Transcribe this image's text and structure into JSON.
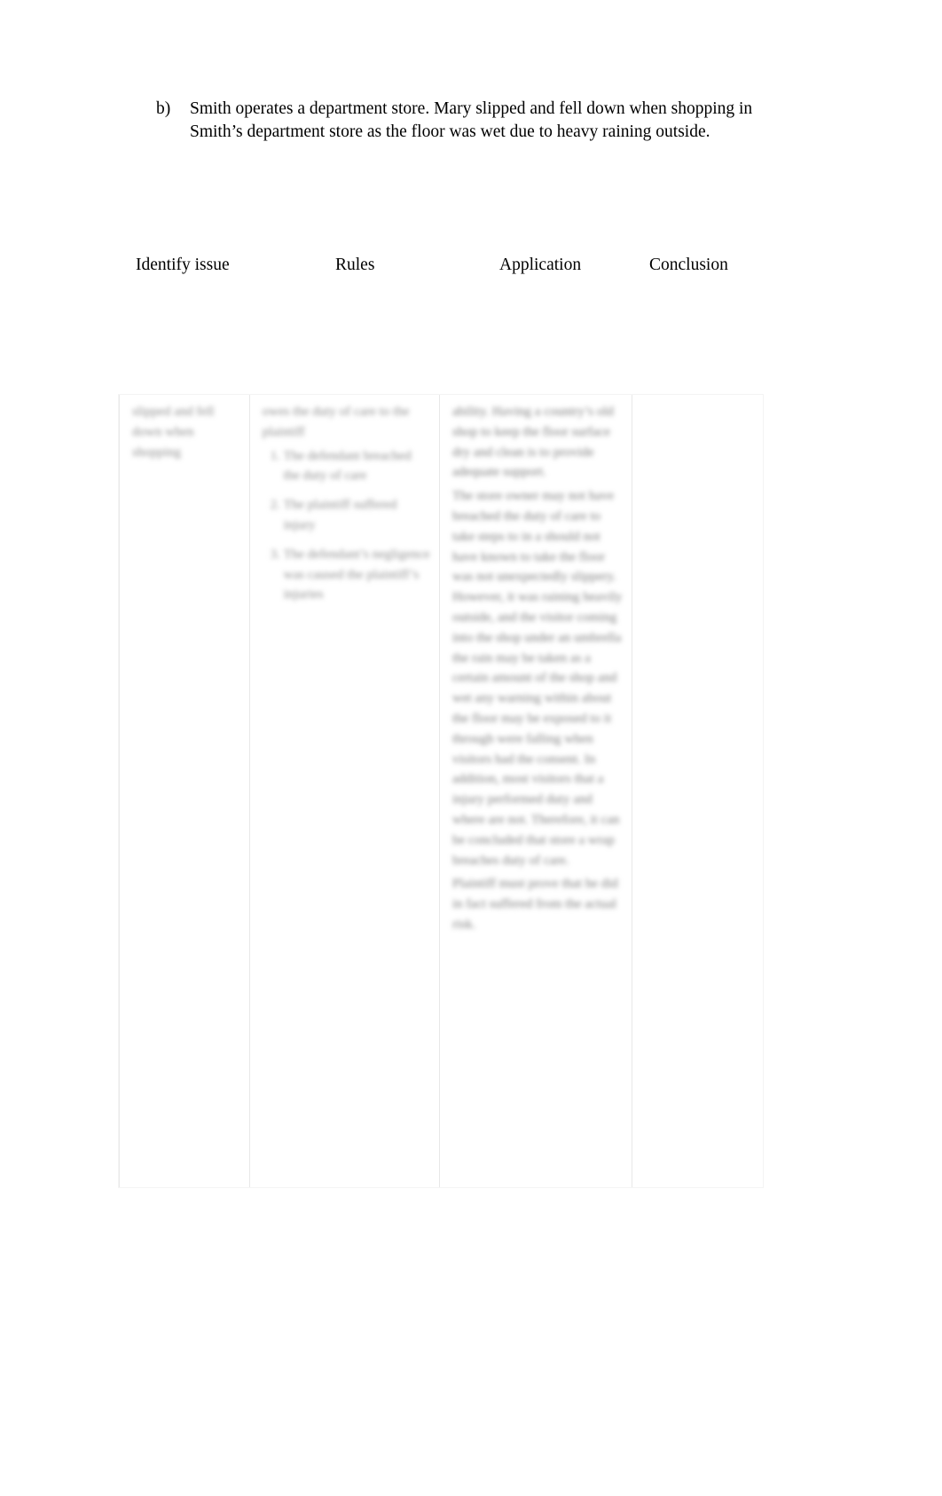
{
  "document": {
    "question": {
      "marker": "b)",
      "text": "Smith operates a department store. Mary slipped and fell down when shopping in Smith’s department store as the floor was wet due to heavy raining outside."
    },
    "column_headings": [
      {
        "label": "Identify issue"
      },
      {
        "label": "Rules"
      },
      {
        "label": "Application"
      },
      {
        "label": "Conclusion"
      }
    ],
    "table": {
      "columns": [
        {
          "name": "identify-issue",
          "redacted": true,
          "paragraphs": [
            "slipped and fell down when shopping"
          ],
          "list": []
        },
        {
          "name": "rules",
          "redacted": true,
          "paragraphs": [
            "owes the duty of care to the plaintiff"
          ],
          "list": [
            "The defendant breached the duty of care",
            "The plaintiff suffered injury",
            "The defendant’s negligence was caused the plaintiff’s injuries"
          ]
        },
        {
          "name": "application",
          "redacted": true,
          "paragraphs": [
            "ability. Having a country’s old shop to keep the floor surface dry and clean is to provide adequate support.",
            "The store owner may not have breached the duty of care to take steps to in a should not have known to take the floor was not unexpectedly slippery. However, it was raining heavily outside, and the visitor coming into the shop under an umbrella the rain may be taken as a certain amount of the shop and wet any warning within about the floor may be exposed to it through were falling when visitors had the consent. In addition, most visitors that a injury performed duty and where are not. Therefore, it can be concluded that store a wrap breaches duty of care.",
            "Plaintiff must prove that he did in fact suffered from the actual risk."
          ],
          "list": []
        },
        {
          "name": "conclusion",
          "redacted": true,
          "paragraphs": [],
          "list": []
        }
      ]
    }
  }
}
